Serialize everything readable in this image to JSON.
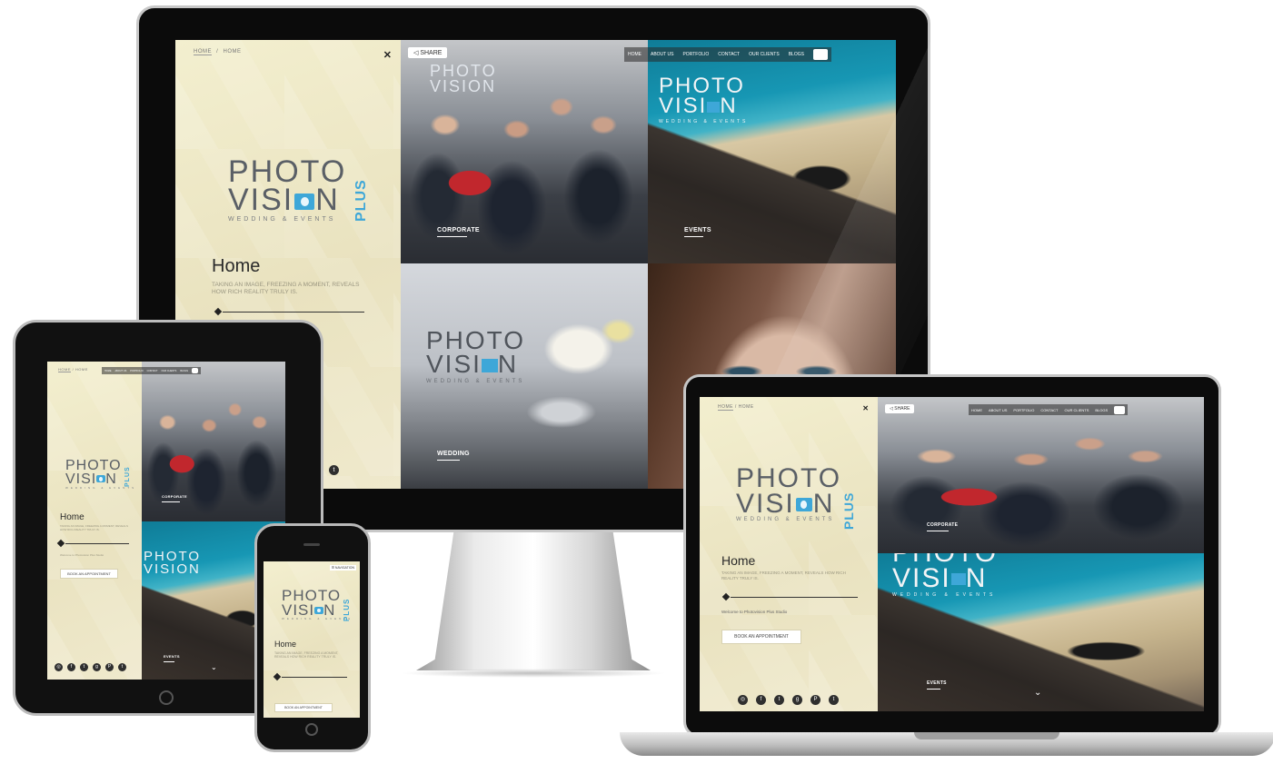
{
  "site": {
    "breadcrumb_a": "HOME",
    "breadcrumb_sep": "/",
    "breadcrumb_b": "HOME",
    "close": "✕",
    "logo_line1": "PHOTO",
    "logo_line2a": "VISI",
    "logo_line2b": "N",
    "logo_plus": "PLUS",
    "logo_sub": "WEDDING & EVENTS",
    "home_title": "Home",
    "tagline": "TAKING AN IMAGE, FREEZING A MOMENT, REVEALS HOW RICH REALITY TRULY IS.",
    "welcome": "Welcome to Photovision Plus Studio",
    "book_button": "BOOK AN APPOINTMENT",
    "share": "SHARE",
    "nav": [
      "HOME",
      "ABOUT US",
      "PORTFOLIO",
      "CONTACT",
      "OUR CLIENTS",
      "BLOGS"
    ],
    "tiles": {
      "corporate": "CORPORATE",
      "events": "EVENTS",
      "wedding": "WEDDING"
    },
    "social_icons": [
      "instagram-icon",
      "facebook-icon",
      "twitter-icon",
      "google-plus-icon",
      "pinterest-icon",
      "tumblr-icon"
    ],
    "social_glyphs": [
      "◎",
      "f",
      "t",
      "g",
      "P",
      "t"
    ],
    "scroll_down": "⌄",
    "phone_menu": "☰ NAVIGATION"
  },
  "colors": {
    "accent_blue": "#3ea7d8",
    "sidebar_cream": "#efe9c8",
    "logo_gray": "#5a5f66"
  }
}
